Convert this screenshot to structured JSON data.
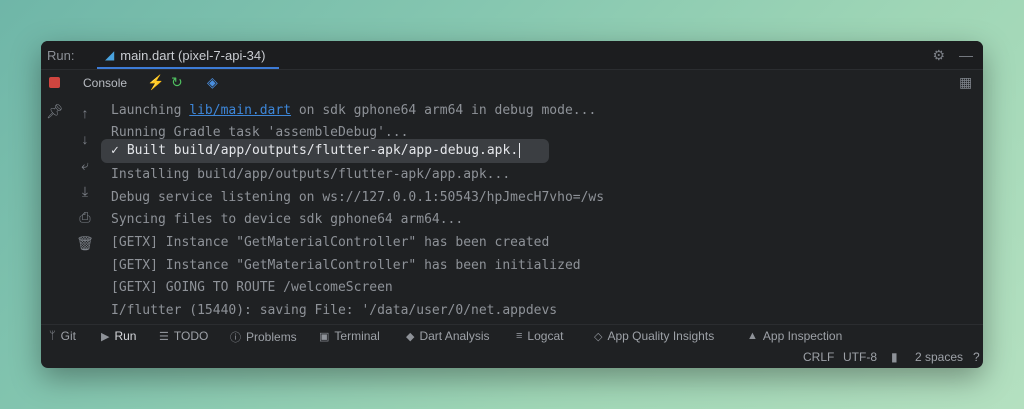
{
  "run_panel": {
    "label": "Run:",
    "tab_title": "main.dart (pixel-7-api-34)",
    "console_label": "Console"
  },
  "console_lines": {
    "l1_prefix": "Launching ",
    "l1_link": "lib/main.dart",
    "l1_suffix": " on sdk gphone64 arm64 in debug mode...",
    "l2": "Running Gradle task 'assembleDebug'...",
    "l3_check": "✓",
    "l3": "Built build/app/outputs/flutter-apk/app-debug.apk.",
    "l4": "Installing build/app/outputs/flutter-apk/app.apk...",
    "l5": "Debug service listening on ws://127.0.0.1:50543/hpJmecH7vho=/ws",
    "l6": "Syncing files to device sdk gphone64 arm64...",
    "l7": "[GETX] Instance \"GetMaterialController\" has been created",
    "l8": "[GETX] Instance \"GetMaterialController\" has been initialized",
    "l9": "[GETX] GOING TO ROUTE /welcomeScreen",
    "l10": "I/flutter (15440): saving File: '/data/user/0/net.appdevs"
  },
  "bottom_tabs": {
    "git": "Git",
    "run": "Run",
    "todo": "TODO",
    "problems": "Problems",
    "terminal": "Terminal",
    "dart_analysis": "Dart Analysis",
    "logcat": "Logcat",
    "app_quality": "App Quality Insights",
    "app_inspection": "App Inspection"
  },
  "status": {
    "line_endings": "CRLF",
    "encoding": "UTF-8",
    "indent": "2 spaces"
  },
  "colors": {
    "accent": "#3d7bd6",
    "stop": "#d0453f",
    "link": "#3d86d8"
  }
}
